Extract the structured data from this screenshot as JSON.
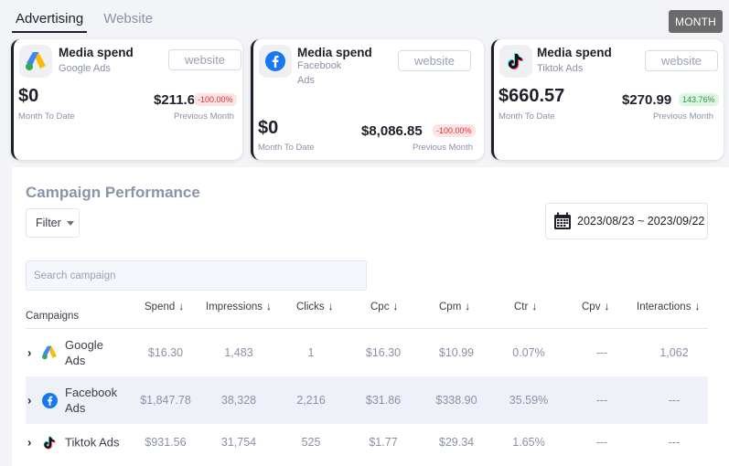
{
  "tabs": [
    {
      "label": "Advertising",
      "active": true
    },
    {
      "label": "Website",
      "active": false
    }
  ],
  "period_button": "MONTH",
  "cards": [
    {
      "title": "Media spend",
      "platform": "Google Ads",
      "website_label": "website",
      "current_value": "$0",
      "current_label": "Month To Date",
      "previous_value": "$211.6",
      "change": "-100.00%",
      "change_type": "negative",
      "previous_label": "Previous Month",
      "icon": "google-ads-icon"
    },
    {
      "title": "Media spend",
      "platform": "Facebook Ads",
      "website_label": "website",
      "current_value": "$0",
      "current_label": "Month To Date",
      "previous_value": "$8,086.85",
      "change": "-100.00%",
      "change_type": "negative",
      "previous_label": "Previous Month",
      "icon": "facebook-icon"
    },
    {
      "title": "Media spend",
      "platform": "Tiktok Ads",
      "website_label": "website",
      "current_value": "$660.57",
      "current_label": "Month To Date",
      "previous_value": "$270.99",
      "change": "143.76%",
      "change_type": "positive",
      "previous_label": "Previous Month",
      "icon": "tiktok-icon"
    }
  ],
  "campaign": {
    "title": "Campaign Performance",
    "filter_label": "Filter",
    "date_range": "2023/08/23 ~ 2023/09/22",
    "search_placeholder": "Search campaign",
    "columns": [
      {
        "label": "Campaigns",
        "sortable": false
      },
      {
        "label": "Spend",
        "sortable": true
      },
      {
        "label": "Impressions",
        "sortable": true
      },
      {
        "label": "Clicks",
        "sortable": true
      },
      {
        "label": "Cpc",
        "sortable": true
      },
      {
        "label": "Cpm",
        "sortable": true
      },
      {
        "label": "Ctr",
        "sortable": true
      },
      {
        "label": "Cpv",
        "sortable": true
      },
      {
        "label": "Interactions",
        "sortable": true
      }
    ],
    "sort_arrow": "↓",
    "rows": [
      {
        "name_line1": "Google",
        "name_line2": "Ads",
        "icon": "google-ads-icon",
        "spend": "$16.30",
        "impressions": "1,483",
        "clicks": "1",
        "cpc": "$16.30",
        "cpm": "$10.99",
        "ctr": "0.07%",
        "cpv": "---",
        "interactions": "1,062"
      },
      {
        "name_line1": "Facebook",
        "name_line2": "Ads",
        "icon": "facebook-icon",
        "spend": "$1,847.78",
        "impressions": "38,328",
        "clicks": "2,216",
        "cpc": "$31.86",
        "cpm": "$338.90",
        "ctr": "35.59%",
        "cpv": "---",
        "interactions": "---"
      },
      {
        "name_line1": "Tiktok Ads",
        "name_line2": "",
        "icon": "tiktok-icon",
        "spend": "$931.56",
        "impressions": "31,754",
        "clicks": "525",
        "cpc": "$1.77",
        "cpm": "$29.34",
        "ctr": "1.65%",
        "cpv": "---",
        "interactions": "---"
      }
    ]
  },
  "colors": {
    "negative_badge_bg": "#fde4e4",
    "negative_badge_text": "#dd3333",
    "positive_badge_bg": "#dff5e3",
    "positive_badge_text": "#2a9a47",
    "facebook_blue": "#1877f2"
  }
}
